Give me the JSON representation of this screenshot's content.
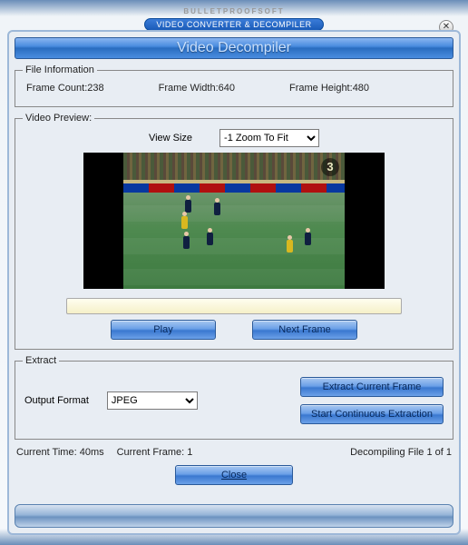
{
  "brand": {
    "company": "BULLETPROOFSOFT",
    "product": "VIDEO CONVERTER & DECOMPILER"
  },
  "title": "Video Decompiler",
  "fileInfo": {
    "legend": "File Information",
    "frameCountLabel": "Frame Count:",
    "frameCount": "238",
    "frameWidthLabel": "Frame Width:",
    "frameWidth": "640",
    "frameHeightLabel": "Frame Height:",
    "frameHeight": "480"
  },
  "preview": {
    "legend": "Video Preview:",
    "viewSizeLabel": "View Size",
    "viewSizeValue": "-1 Zoom To Fit",
    "playLabel": "Play",
    "nextFrameLabel": "Next Frame",
    "channelLogo": "3"
  },
  "extract": {
    "legend": "Extract",
    "outputFormatLabel": "Output Format",
    "outputFormatValue": "JPEG",
    "extractCurrentLabel": "Extract Current Frame",
    "startContinuousLabel": "Start Continuous Extraction"
  },
  "status": {
    "currentTimeLabel": "Current Time:",
    "currentTime": "40ms",
    "currentFrameLabel": "Current Frame:",
    "currentFrame": "1",
    "decompilingLabel": "Decompiling File 1 of 1"
  },
  "closeLabel": "Close"
}
